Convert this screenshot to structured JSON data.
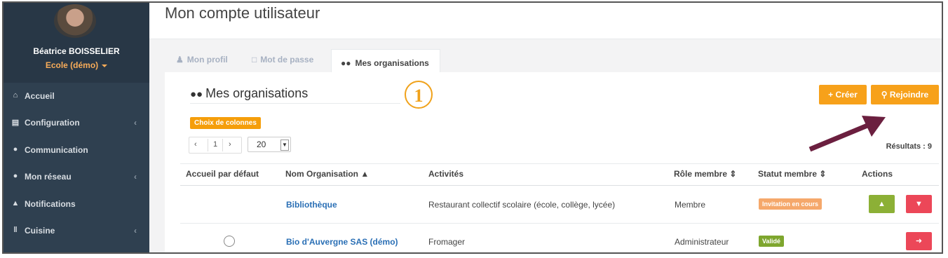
{
  "user": {
    "name": "Béatrice BOISSELIER",
    "school": "Ecole (démo)"
  },
  "nav": [
    {
      "icon": "home-icon",
      "glyph": "⌂",
      "label": "Accueil",
      "has_chevron": false
    },
    {
      "icon": "bank-icon",
      "glyph": "⌂",
      "label": "Configuration",
      "has_chevron": true
    },
    {
      "icon": "comments-icon",
      "glyph": "●",
      "label": "Communication",
      "has_chevron": false
    },
    {
      "icon": "users-icon",
      "glyph": "●",
      "label": "Mon réseau",
      "has_chevron": true
    },
    {
      "icon": "bell-icon",
      "glyph": "▲",
      "label": "Notifications",
      "has_chevron": false
    },
    {
      "icon": "cutlery-icon",
      "glyph": "‖",
      "label": "Cuisine",
      "has_chevron": true
    }
  ],
  "page": {
    "title": "Mon compte utilisateur"
  },
  "tabs": {
    "profile": "Mon profil",
    "password": "Mot de passe",
    "organisations": "Mes organisations"
  },
  "section": {
    "title": "Mes organisations",
    "step_marker": "1",
    "create_label": "+ Créer",
    "join_label": "Rejoindre",
    "columns_label": "Choix de colonnes",
    "results_label": "Résultats : 9"
  },
  "pagination": {
    "prev": "‹",
    "page": "1",
    "next": "›",
    "page_size": "20"
  },
  "table": {
    "headers": {
      "default_home": "Accueil par défaut",
      "org_name": "Nom Organisation ▲",
      "activities": "Activités",
      "member_role": "Rôle membre ⇕",
      "member_status": "Statut membre ⇕",
      "actions": "Actions"
    },
    "rows": [
      {
        "name": "Bibliothèque",
        "activity": "Restaurant collectif scolaire (école, collège, lycée)",
        "role": "Membre",
        "status": "Invitation en cours"
      },
      {
        "name": "Bio d'Auvergne SAS (démo)",
        "activity": "Fromager",
        "role": "Administrateur",
        "status": "Validé"
      }
    ]
  },
  "colors": {
    "sidebar": "#2f4050",
    "accent": "#f7a11a",
    "success": "#8cb036",
    "danger": "#ec4758",
    "pending": "#f5a86b",
    "annotation_arrow": "#6b1f3f"
  }
}
